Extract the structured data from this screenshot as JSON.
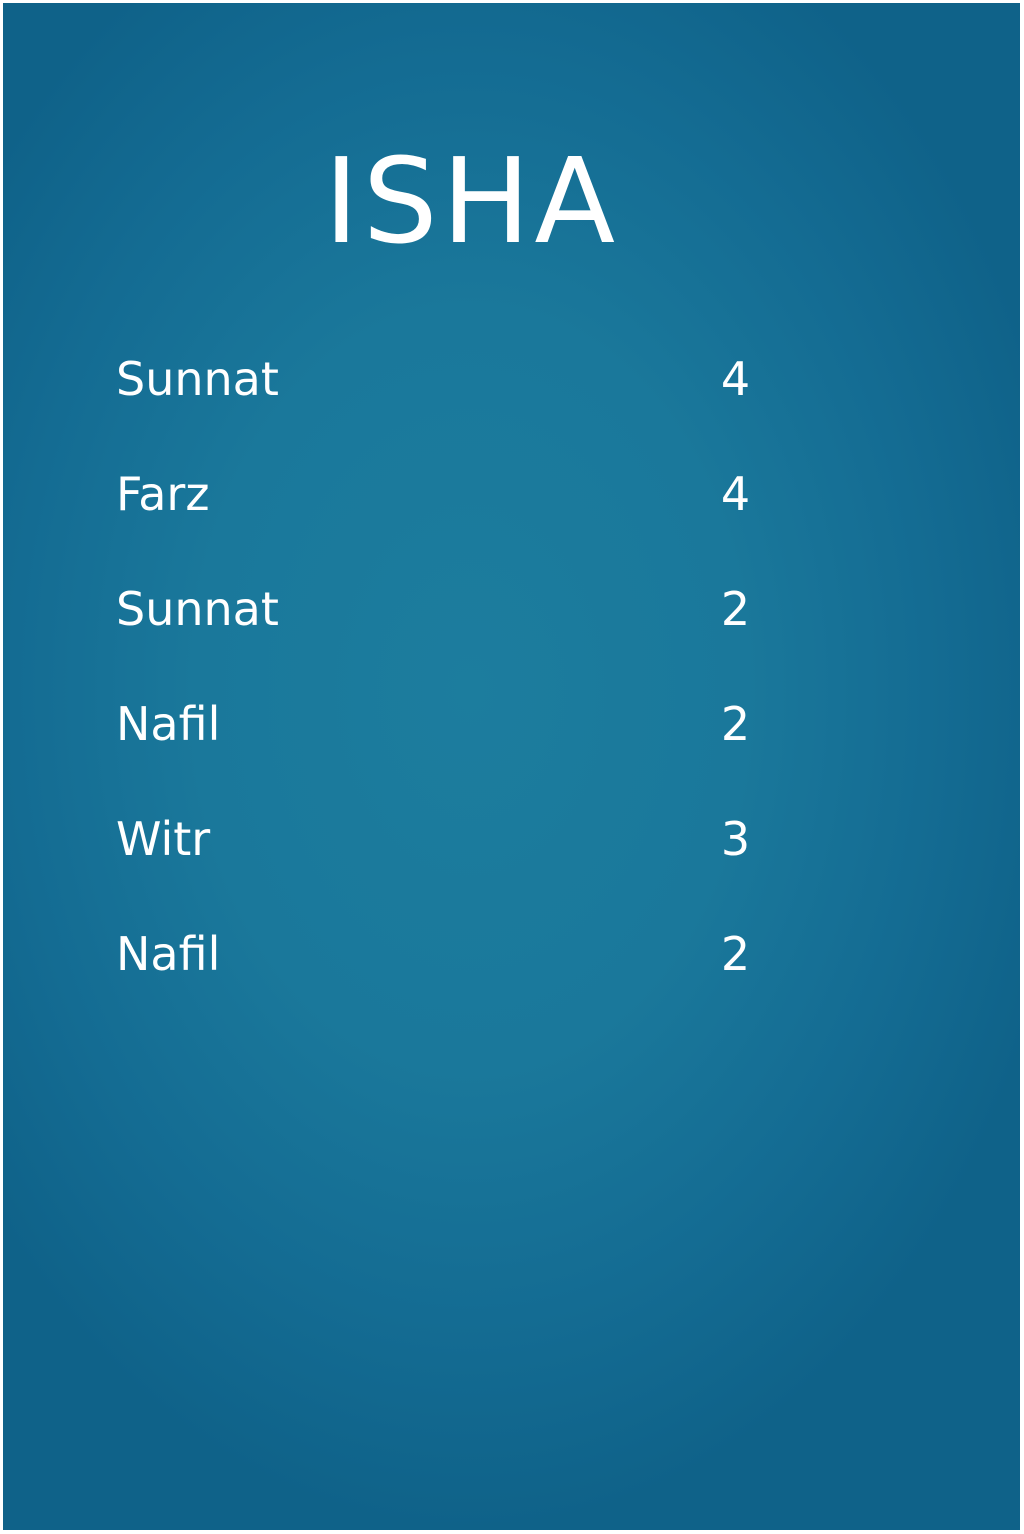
{
  "title": "ISHA",
  "rows": [
    {
      "name": "Sunnat",
      "count": "4"
    },
    {
      "name": "Farz",
      "count": "4"
    },
    {
      "name": "Sunnat",
      "count": "2"
    },
    {
      "name": "Nafil",
      "count": "2"
    },
    {
      "name": "Witr",
      "count": "3"
    },
    {
      "name": "Nafil",
      "count": "2"
    }
  ],
  "colors": {
    "background": "#1a789b",
    "text": "#ffffff"
  }
}
